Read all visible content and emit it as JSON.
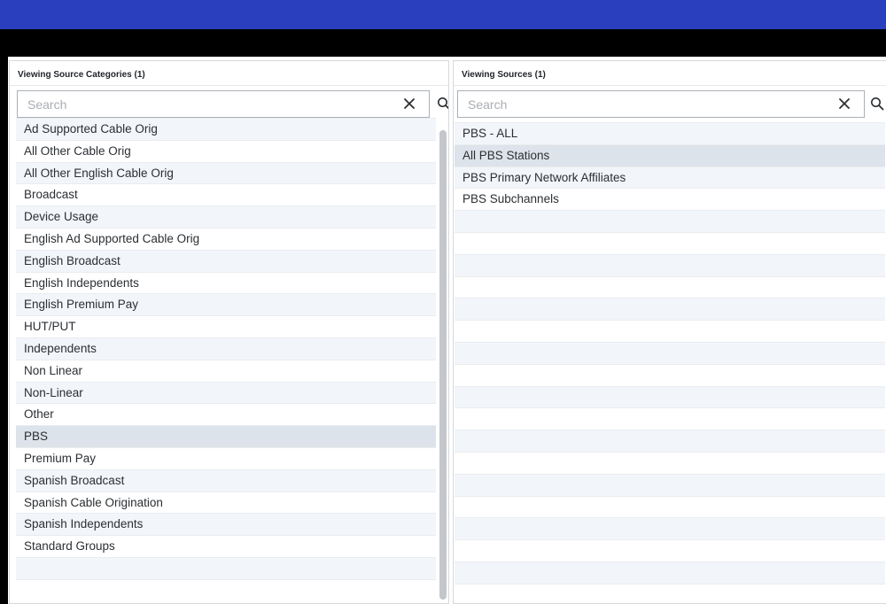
{
  "left_panel": {
    "title": "Viewing Source Categories (1)",
    "search": {
      "placeholder": "Search",
      "value": ""
    },
    "items": [
      "Ad Supported Cable Orig",
      "All Other Cable Orig",
      "All Other English Cable Orig",
      "Broadcast",
      "Device Usage",
      "English Ad Supported Cable Orig",
      "English Broadcast",
      "English Independents",
      "English Premium Pay",
      "HUT/PUT",
      "Independents",
      "Non Linear",
      "Non-Linear",
      "Other",
      "PBS",
      "Premium Pay",
      "Spanish Broadcast",
      "Spanish Cable Origination",
      "Spanish Independents",
      "Standard Groups"
    ],
    "selected_item": "PBS"
  },
  "right_panel": {
    "title": "Viewing Sources (1)",
    "search": {
      "placeholder": "Search",
      "value": ""
    },
    "items": [
      "PBS - ALL",
      "All PBS Stations",
      "PBS Primary Network Affiliates",
      "PBS Subchannels"
    ],
    "selected_item": "All PBS Stations"
  },
  "icons": {
    "clear": "close-icon",
    "search": "search-icon"
  },
  "colors": {
    "header_blue": "#2a3fbe",
    "selected_row": "#dde3ea",
    "alt_row": "#f2f6fa"
  }
}
